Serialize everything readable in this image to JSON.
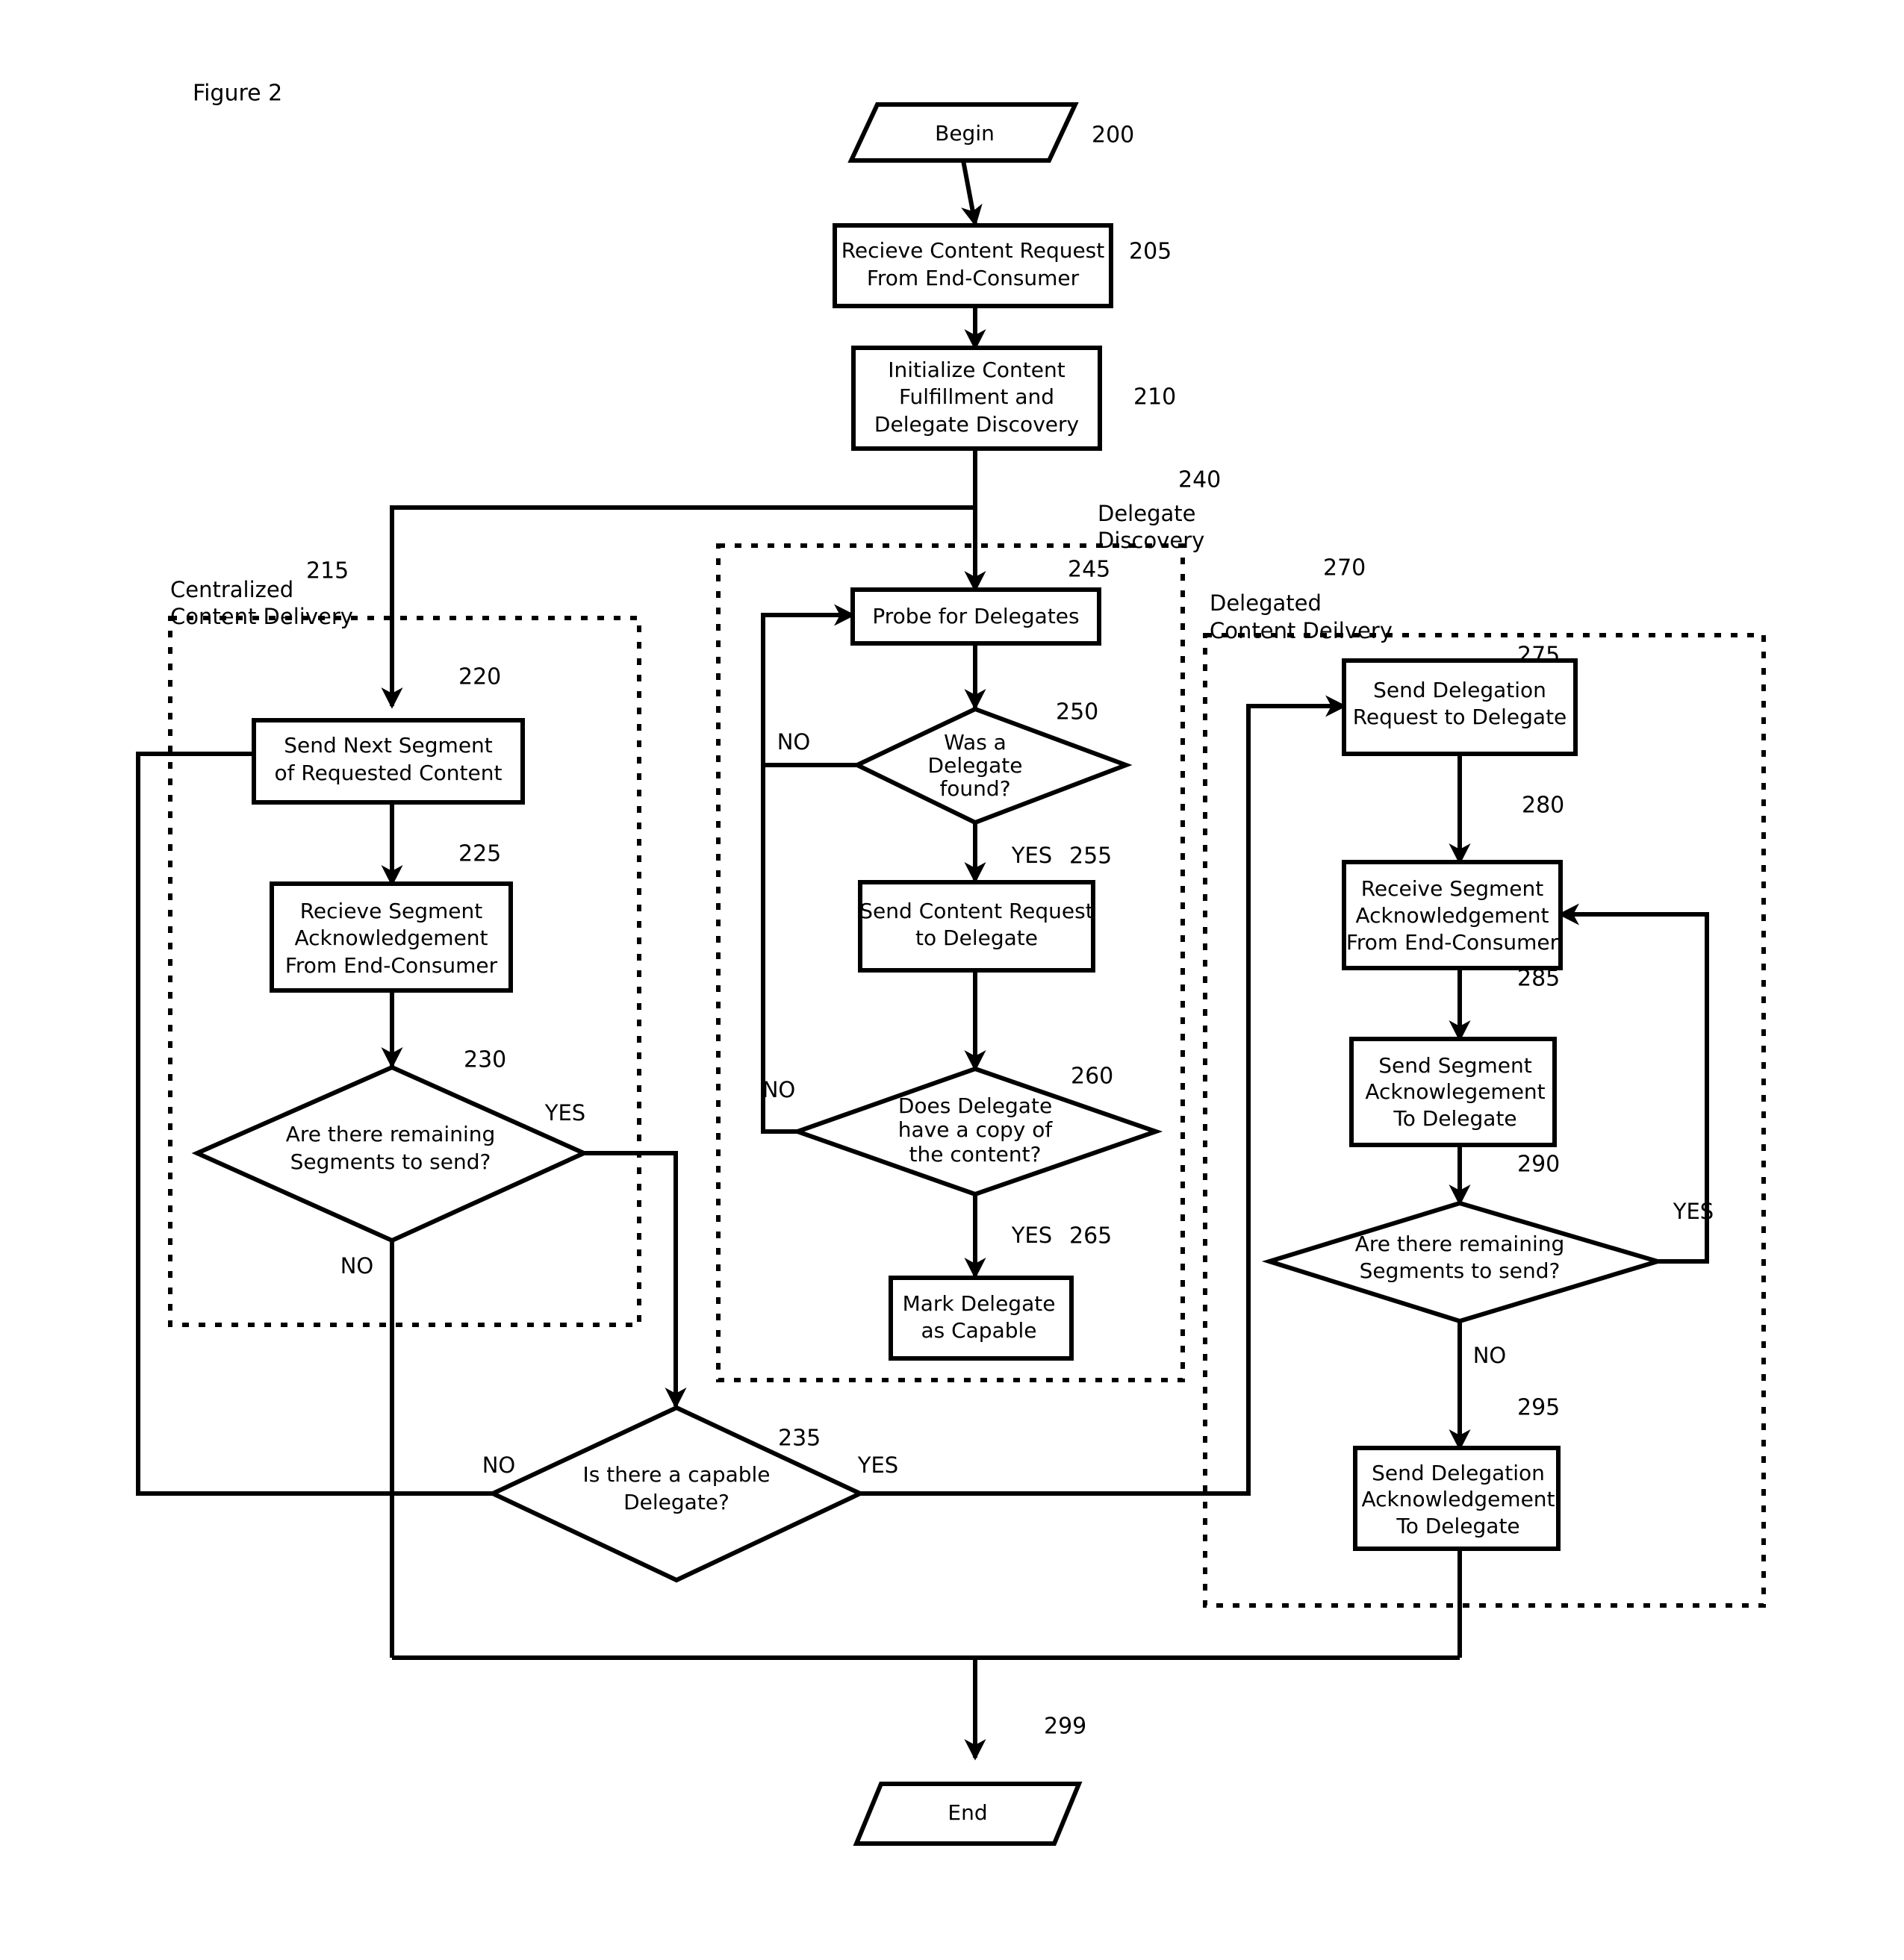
{
  "figure": {
    "title": "Figure 2"
  },
  "nodes": {
    "begin": {
      "label": "Begin",
      "ref": "200",
      "shape": "parallelogram"
    },
    "n205": {
      "line1": "Recieve Content Request",
      "line2": "From End-Consumer",
      "ref": "205",
      "shape": "process"
    },
    "n210": {
      "line1": "Initialize Content",
      "line2": "Fulfillment and",
      "line3": "Delegate Discovery",
      "ref": "210",
      "shape": "process"
    },
    "n220": {
      "line1": "Send Next Segment",
      "line2": "of Requested Content",
      "ref": "220",
      "shape": "process"
    },
    "n225": {
      "line1": "Recieve Segment",
      "line2": "Acknowledgement",
      "line3": "From End-Consumer",
      "ref": "225",
      "shape": "process"
    },
    "n230": {
      "line1": "Are there remaining",
      "line2": "Segments to send?",
      "ref": "230",
      "shape": "decision"
    },
    "n235": {
      "line1": "Is there a capable",
      "line2": "Delegate?",
      "ref": "235",
      "shape": "decision"
    },
    "n245": {
      "line1": "Probe for Delegates",
      "ref": "245",
      "shape": "process"
    },
    "n250": {
      "line1": "Was a",
      "line2": "Delegate",
      "line3": "found?",
      "ref": "250",
      "shape": "decision"
    },
    "n255": {
      "line1": "Send Content Request",
      "line2": "to Delegate",
      "ref": "255",
      "shape": "process"
    },
    "n260": {
      "line1": "Does Delegate",
      "line2": "have a copy of",
      "line3": "the content?",
      "ref": "260",
      "shape": "decision"
    },
    "n265": {
      "line1": "Mark Delegate",
      "line2": "as Capable",
      "ref": "265",
      "shape": "process"
    },
    "n275": {
      "line1": "Send Delegation",
      "line2": "Request to Delegate",
      "ref": "275",
      "shape": "process"
    },
    "n280": {
      "line1": "Receive Segment",
      "line2": "Acknowledgement",
      "line3": "From End-Consumer",
      "ref": "280",
      "shape": "process"
    },
    "n285": {
      "line1": "Send Segment",
      "line2": "Acknowlegement",
      "line3": "To Delegate",
      "ref": "285",
      "shape": "process"
    },
    "n290": {
      "line1": "Are there remaining",
      "line2": "Segments to send?",
      "ref": "290",
      "shape": "decision"
    },
    "n295": {
      "line1": "Send Delegation",
      "line2": "Acknowledgement",
      "line3": "To Delegate",
      "ref": "295",
      "shape": "process"
    },
    "end": {
      "label": "End",
      "ref": "299",
      "shape": "parallelogram"
    }
  },
  "groups": {
    "centralized": {
      "line1": "Centralized",
      "line2": "Content Delivery",
      "ref": "215"
    },
    "discovery": {
      "line1": "Delegate",
      "line2": "Discovery",
      "ref": "240"
    },
    "delegated": {
      "line1": "Delegated",
      "line2": "Content Deilvery",
      "ref": "270"
    }
  },
  "branch_labels": {
    "yes": "YES",
    "no": "NO",
    "n230_yes": "YES",
    "n230_no": "NO",
    "n235_yes": "YES",
    "n235_no": "NO",
    "n250_no": "NO",
    "n250_yes": "YES",
    "n260_no": "NO",
    "n260_yes": "YES",
    "n290_yes": "YES",
    "n290_no": "NO"
  },
  "colors": {
    "stroke": "#000000",
    "fill": "#ffffff",
    "background": "#ffffff"
  }
}
